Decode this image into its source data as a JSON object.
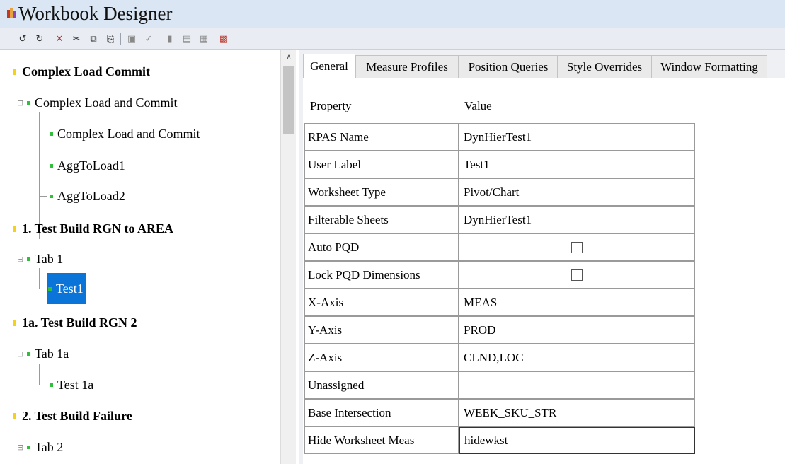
{
  "window": {
    "title": "Workbook Designer"
  },
  "toolbar": {
    "buttons": [
      "undo-icon",
      "redo-icon",
      "delete-icon",
      "cut-icon",
      "copy-icon",
      "paste-icon",
      "image-icon",
      "check-icon",
      "tile-icon",
      "arrange-icon",
      "grid-icon",
      "wizard-icon"
    ]
  },
  "tree": {
    "n1": "Complex Load Commit",
    "n2": "Complex Load and Commit",
    "n3": "Complex Load and Commit",
    "n4": "AggToLoad1",
    "n5": "AggToLoad2",
    "n6": "1.  Test Build RGN to AREA",
    "n7": "Tab 1",
    "n8": "Test1",
    "n9": "1a. Test Build RGN 2",
    "n10": "Tab 1a",
    "n11": "Test 1a",
    "n12": "2. Test Build Failure",
    "n13": "Tab 2"
  },
  "tabs": {
    "general": "General",
    "measure_profiles": "Measure Profiles",
    "position_queries": "Position Queries",
    "style_overrides": "Style Overrides",
    "window_formatting": "Window Formatting"
  },
  "grid": {
    "header_property": "Property",
    "header_value": "Value",
    "rows": [
      {
        "property": "RPAS Name",
        "value": "DynHierTest1"
      },
      {
        "property": "User Label",
        "value": "Test1"
      },
      {
        "property": "Worksheet Type",
        "value": "Pivot/Chart"
      },
      {
        "property": "Filterable Sheets",
        "value": "DynHierTest1"
      },
      {
        "property": "Auto PQD",
        "value": "",
        "checked": false
      },
      {
        "property": "Lock PQD Dimensions",
        "value": "",
        "checked": false
      },
      {
        "property": "X-Axis",
        "value": "MEAS"
      },
      {
        "property": "Y-Axis",
        "value": "PROD"
      },
      {
        "property": "Z-Axis",
        "value": "CLND,LOC"
      },
      {
        "property": "Unassigned",
        "value": ""
      },
      {
        "property": "Base Intersection",
        "value": "WEEK_SKU_STR"
      },
      {
        "property": "Hide Worksheet Meas",
        "value": "hidewkst"
      }
    ]
  },
  "colors": {
    "selection": "#0a74d9",
    "folder_marker": "#f2d21b",
    "item_marker": "#2fbf3a"
  }
}
